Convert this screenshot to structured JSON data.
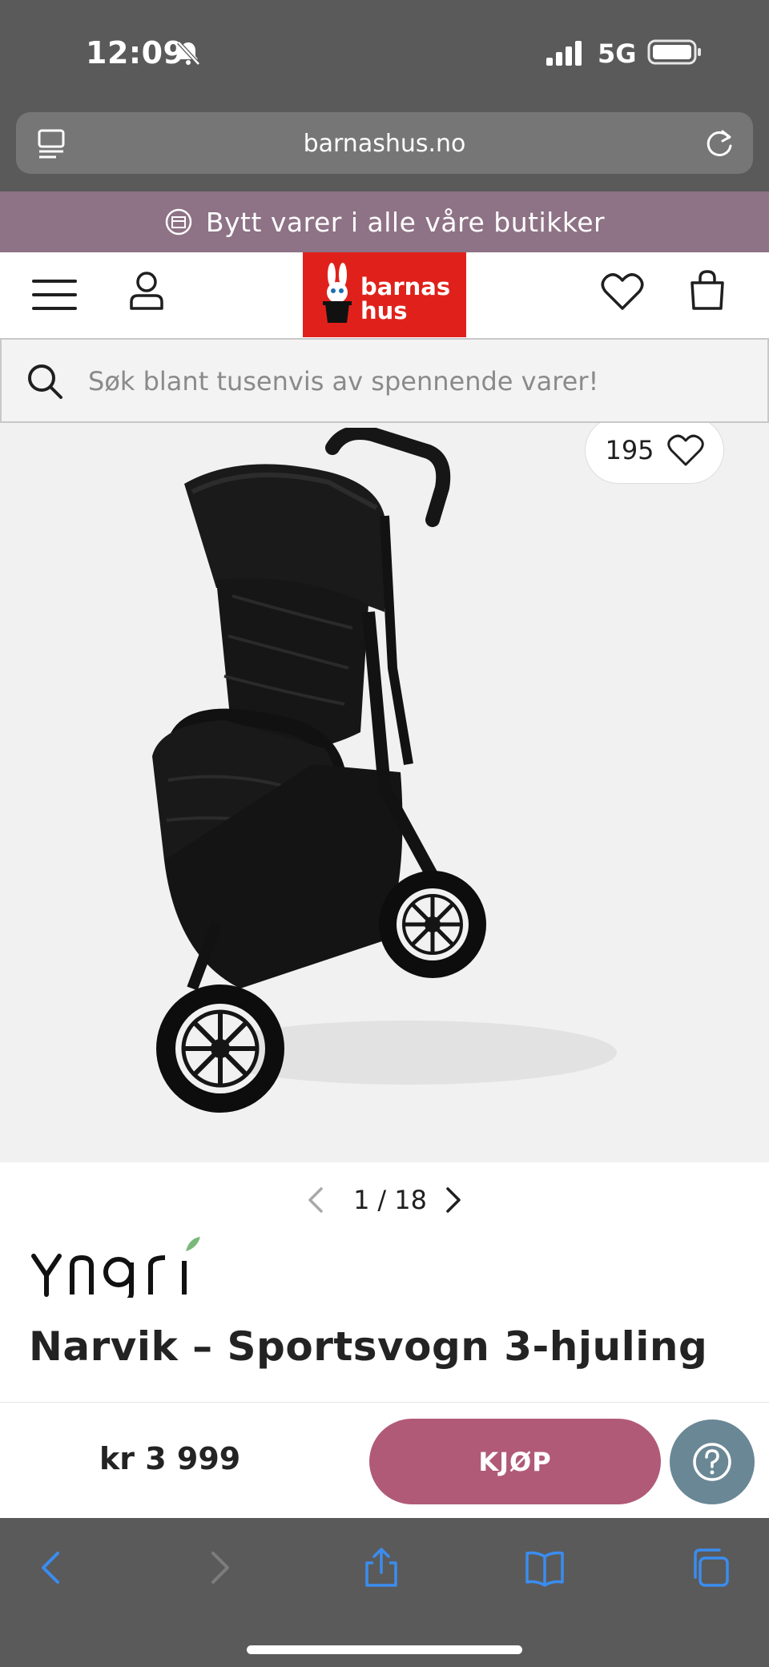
{
  "status_bar": {
    "time": "12:09",
    "network": "5G"
  },
  "browser": {
    "url": "barnashus.no"
  },
  "promo": {
    "text": "Bytt varer i alle våre butikker"
  },
  "header": {
    "logo_line1": "barnas",
    "logo_line2": "hus",
    "logo_color": "#e0211b"
  },
  "search": {
    "placeholder": "Søk blant tusenvis av spennende varer!"
  },
  "product": {
    "favorite_count": "195",
    "image_index": "1",
    "image_separator": "/",
    "image_total": "18",
    "brand": "Yngri",
    "title": "Narvik – Sportsvogn 3-hjuling",
    "price": "kr 3 999",
    "buy_label": "KJØP"
  },
  "colors": {
    "promo_bg": "#8e7285",
    "buy_button": "#b15a78",
    "help_button": "#6a8795",
    "toolbar_icons": "#3a8df0"
  },
  "icons": {
    "toolbar": [
      "back-icon",
      "forward-icon",
      "share-icon",
      "bookmarks-icon",
      "tabs-icon"
    ]
  }
}
